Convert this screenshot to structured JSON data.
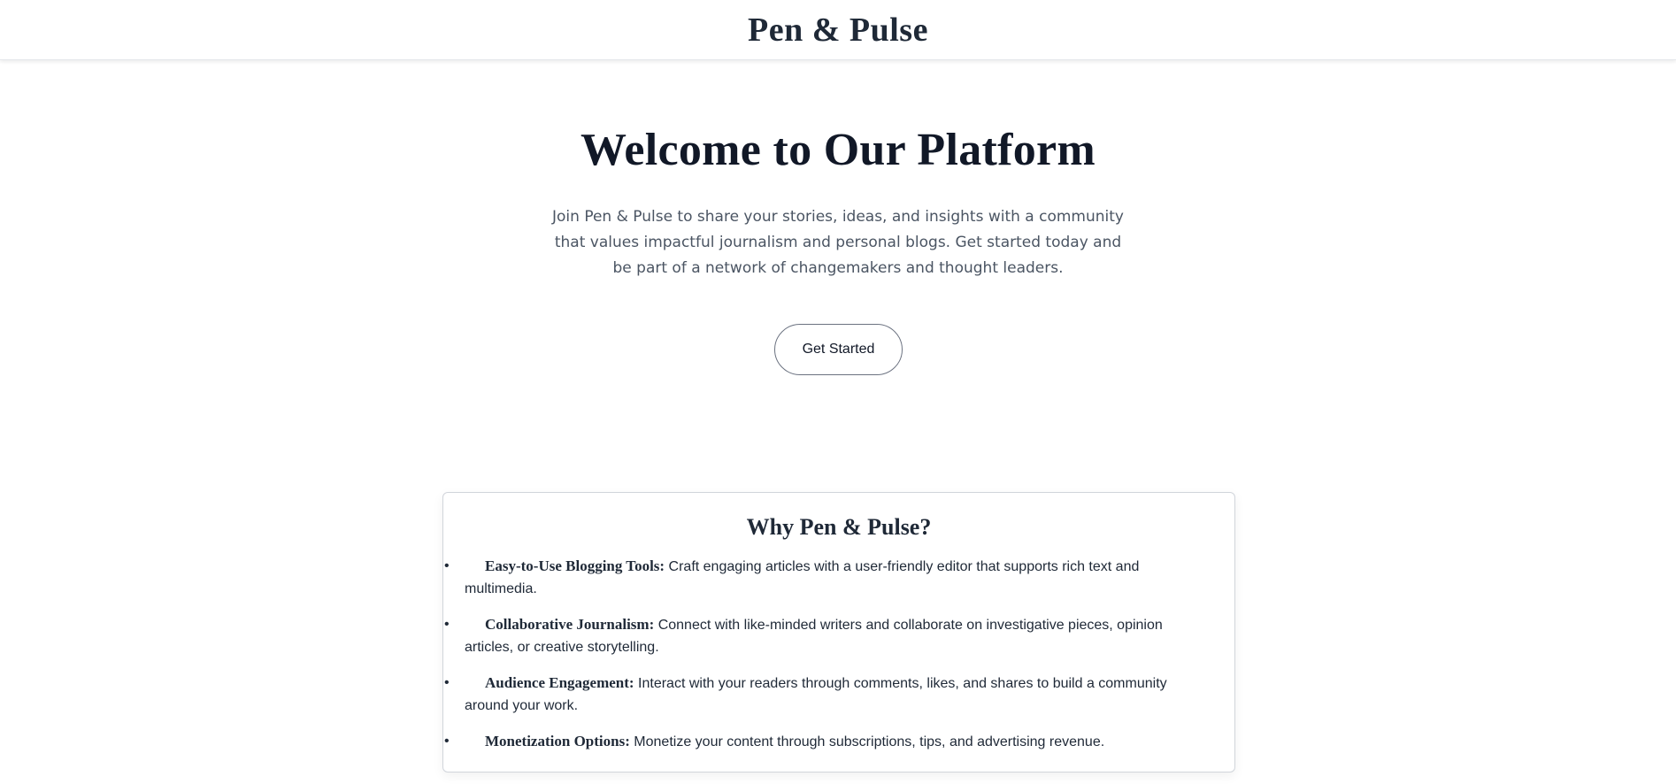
{
  "header": {
    "brand": "Pen & Pulse"
  },
  "hero": {
    "title": "Welcome to Our Platform",
    "description": "Join Pen & Pulse to share your stories, ideas, and insights with a community that values impactful journalism and personal blogs. Get started today and be part of a network of changemakers and thought leaders.",
    "cta_label": "Get Started"
  },
  "features": {
    "title": "Why Pen & Pulse?",
    "items": [
      {
        "title": "Easy-to-Use Blogging Tools:",
        "text": " Craft engaging articles with a user-friendly editor that supports rich text and multimedia."
      },
      {
        "title": "Collaborative Journalism:",
        "text": " Connect with like-minded writers and collaborate on investigative pieces, opinion articles, or creative storytelling."
      },
      {
        "title": "Audience Engagement:",
        "text": " Interact with your readers through comments, likes, and shares to build a community around your work."
      },
      {
        "title": "Monetization Options:",
        "text": " Monetize your content through subscriptions, tips, and advertising revenue."
      }
    ]
  }
}
